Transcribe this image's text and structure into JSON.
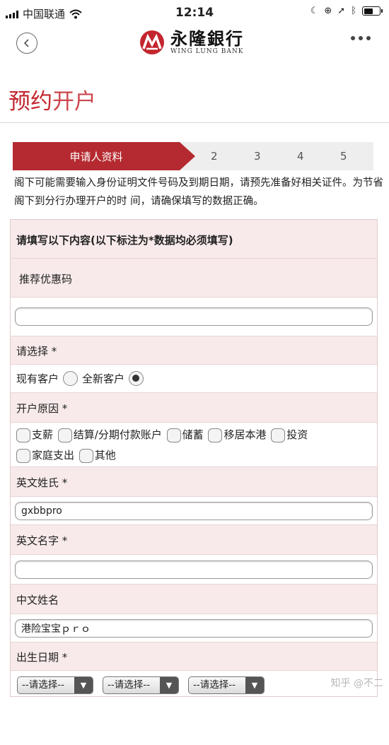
{
  "status_bar": {
    "carrier": "中国联通",
    "time": "12:14"
  },
  "header": {
    "bank_name_cn": "永隆銀行",
    "bank_name_en": "WING LUNG BANK"
  },
  "page_title": {
    "part1": "预约",
    "part2": "开户"
  },
  "steps": {
    "active": "申请人资料",
    "others": [
      "2",
      "3",
      "4",
      "5"
    ]
  },
  "notice": "阁下可能需要输入身份证明文件号码及到期日期，请预先准备好相关证件。为节省阁下到分行办理开户的时 间，请确保填写的数据正确。",
  "form": {
    "intro": "请填写以下内容(以下标注为*数据均必须填写)",
    "referral_label": "推荐优惠码",
    "referral_value": "",
    "customer_type_label": "请选择 *",
    "customer_options": [
      {
        "label": "现有客户",
        "checked": false
      },
      {
        "label": "全新客户",
        "checked": true
      }
    ],
    "reason_label": "开户原因 *",
    "reasons": [
      "支薪",
      "结算/分期付款账户",
      "储蓄",
      "移居本港",
      "投资",
      "家庭支出",
      "其他"
    ],
    "surname_label": "英文姓氏 *",
    "surname_value": "gxbbpro",
    "given_name_label": "英文名字 *",
    "given_name_value": "",
    "chinese_name_label": "中文姓名",
    "chinese_name_value": "港险宝宝ｐｒｏ",
    "dob_label": "出生日期 *",
    "dob_selects": [
      "--请选择--",
      "--请选择--",
      "--请选择--"
    ]
  },
  "watermark": "知乎 @不二",
  "colors": {
    "brand_red": "#b52a30",
    "row_pink": "#f8eaea"
  }
}
